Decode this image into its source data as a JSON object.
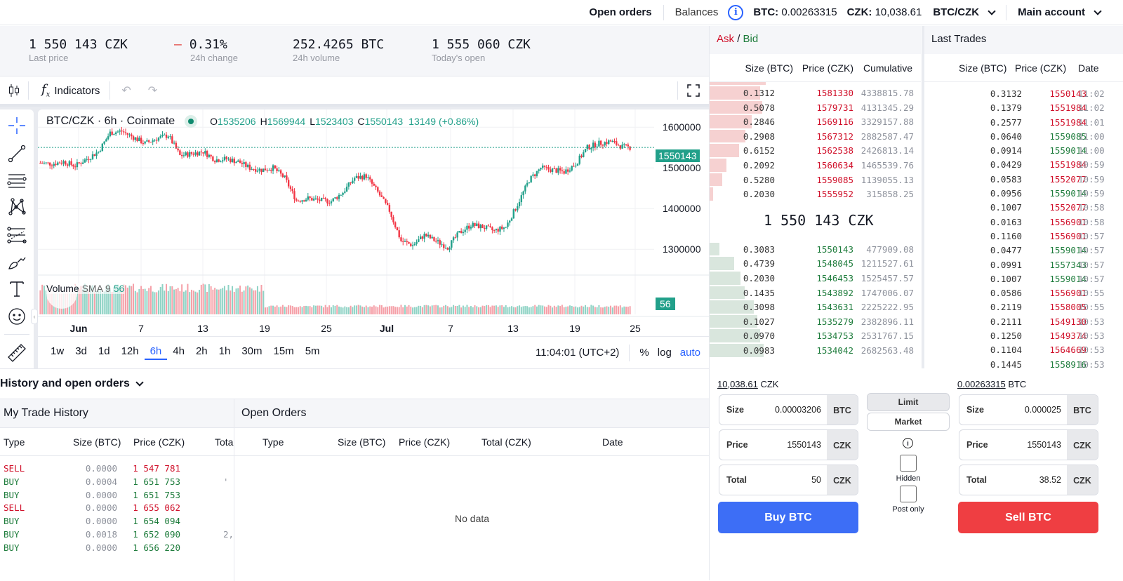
{
  "topbar": {
    "open_orders": "Open orders",
    "balances": "Balances",
    "btc_label": "BTC:",
    "btc_value": "0.00263315",
    "czk_label": "CZK:",
    "czk_value": "10,038.61",
    "pair": "BTC/CZK",
    "account": "Main account",
    "info_glyph": "i"
  },
  "stats": [
    {
      "value": "1 550 143 CZK",
      "label": "Last price"
    },
    {
      "value": "0.31%",
      "label": "24h change",
      "sign": "—"
    },
    {
      "value": "252.4265 BTC",
      "label": "24h volume"
    },
    {
      "value": "1 555 060 CZK",
      "label": "Today's open"
    }
  ],
  "chart_toolbar": {
    "indicators": "Indicators",
    "fx_glyph": "f",
    "fx_sub": "x"
  },
  "chart": {
    "symbol": "BTC/CZK · 6h · Coinmate",
    "o_label": "O",
    "o": "1535206",
    "h_label": "H",
    "h": "1569944",
    "l_label": "L",
    "l": "1523403",
    "c_label": "C",
    "c": "1550143",
    "change": "13149 (+0.86%)",
    "price_tag": "1550143",
    "volume_label": "Volume",
    "sma_label": "SMA 9",
    "sma_value": "56",
    "volume_tag": "56",
    "timestamp": "11:04:01 (UTC+2)",
    "pct": "%",
    "log": "log",
    "auto": "auto",
    "intervals": [
      "1w",
      "3d",
      "1d",
      "12h",
      "6h",
      "4h",
      "2h",
      "1h",
      "30m",
      "15m",
      "5m"
    ],
    "active_interval": "6h"
  },
  "chart_data": {
    "type": "candlestick",
    "title": "BTC/CZK · 6h · Coinmate",
    "y_ticks": [
      "1600000",
      "1500000",
      "1400000",
      "1300000"
    ],
    "ylim": [
      1240000,
      1640000
    ],
    "x_ticks": [
      "Jun",
      "7",
      "13",
      "19",
      "25",
      "Jul",
      "7",
      "13",
      "19",
      "25"
    ],
    "last_price": 1550143,
    "colors": {
      "up": "#22a08a",
      "down": "#f23645",
      "up_vol": "#8fd3c5",
      "down_vol": "#f5a0a8"
    },
    "anchors": [
      [
        0,
        1512000
      ],
      [
        6,
        1510000
      ],
      [
        12,
        1515000
      ],
      [
        18,
        1505000
      ],
      [
        24,
        1522000
      ],
      [
        30,
        1540000
      ],
      [
        36,
        1586000
      ],
      [
        42,
        1590000
      ],
      [
        48,
        1575000
      ],
      [
        54,
        1560000
      ],
      [
        60,
        1572000
      ],
      [
        66,
        1580000
      ],
      [
        72,
        1530000
      ],
      [
        78,
        1535000
      ],
      [
        84,
        1540000
      ],
      [
        90,
        1520000
      ],
      [
        96,
        1522000
      ],
      [
        102,
        1515000
      ],
      [
        108,
        1500000
      ],
      [
        114,
        1495000
      ],
      [
        120,
        1500000
      ],
      [
        126,
        1475000
      ],
      [
        132,
        1420000
      ],
      [
        138,
        1425000
      ],
      [
        144,
        1420000
      ],
      [
        150,
        1418000
      ],
      [
        156,
        1440000
      ],
      [
        162,
        1475000
      ],
      [
        168,
        1480000
      ],
      [
        174,
        1440000
      ],
      [
        180,
        1395000
      ],
      [
        186,
        1320000
      ],
      [
        192,
        1310000
      ],
      [
        198,
        1335000
      ],
      [
        204,
        1320000
      ],
      [
        210,
        1305000
      ],
      [
        216,
        1340000
      ],
      [
        222,
        1360000
      ],
      [
        228,
        1355000
      ],
      [
        234,
        1345000
      ],
      [
        240,
        1355000
      ],
      [
        246,
        1410000
      ],
      [
        252,
        1470000
      ],
      [
        258,
        1500000
      ],
      [
        264,
        1495000
      ],
      [
        270,
        1490000
      ],
      [
        276,
        1510000
      ],
      [
        282,
        1550000
      ],
      [
        288,
        1560000
      ],
      [
        294,
        1565000
      ],
      [
        300,
        1552000
      ],
      [
        304,
        1550143
      ]
    ],
    "volume_levels": {
      "jun_start_to_jun21": 0.8,
      "jun22_to_end": 0.25
    }
  },
  "orderbook": {
    "title_ask": "Ask",
    "title_sep": "/",
    "title_bid": "Bid",
    "columns": [
      "Size (BTC)",
      "Price (CZK)",
      "Cumulative"
    ],
    "mid_price": "1 550 143 CZK",
    "asks": [
      {
        "size": "0.1312",
        "price": "1581330",
        "cum": "4338815.78",
        "depth": 0.24
      },
      {
        "size": "0.5078",
        "price": "1579731",
        "cum": "4131345.29",
        "depth": 0.25
      },
      {
        "size": "0.2846",
        "price": "1569116",
        "cum": "3329157.88",
        "depth": 0.2
      },
      {
        "size": "0.2908",
        "price": "1567312",
        "cum": "2882587.47",
        "depth": 0.17
      },
      {
        "size": "0.6152",
        "price": "1562538",
        "cum": "2426813.14",
        "depth": 0.14
      },
      {
        "size": "0.2092",
        "price": "1560634",
        "cum": "1465539.76",
        "depth": 0.08
      },
      {
        "size": "0.5280",
        "price": "1559085",
        "cum": "1139055.13",
        "depth": 0.06
      },
      {
        "size": "0.2030",
        "price": "1555952",
        "cum": "315858.25",
        "depth": 0.018
      }
    ],
    "bids": [
      {
        "size": "0.3083",
        "price": "1550143",
        "cum": "477909.08",
        "depth": 0.045
      },
      {
        "size": "0.4739",
        "price": "1548045",
        "cum": "1211527.61",
        "depth": 0.115
      },
      {
        "size": "0.2030",
        "price": "1546453",
        "cum": "1525457.57",
        "depth": 0.145
      },
      {
        "size": "0.1435",
        "price": "1543892",
        "cum": "1747006.07",
        "depth": 0.165
      },
      {
        "size": "0.3098",
        "price": "1543631",
        "cum": "2225222.95",
        "depth": 0.21
      },
      {
        "size": "0.1027",
        "price": "1535279",
        "cum": "2382896.11",
        "depth": 0.225
      },
      {
        "size": "0.0970",
        "price": "1534753",
        "cum": "2531767.15",
        "depth": 0.24
      },
      {
        "size": "0.0983",
        "price": "1534042",
        "cum": "2682563.48",
        "depth": 0.255
      }
    ]
  },
  "last_trades": {
    "title": "Last Trades",
    "columns": [
      "Size (BTC)",
      "Price (CZK)",
      "Date"
    ],
    "rows": [
      {
        "size": "0.3132",
        "price": "1550143",
        "time": "11:02",
        "side": "sell"
      },
      {
        "size": "0.1379",
        "price": "1551984",
        "time": "11:02",
        "side": "sell"
      },
      {
        "size": "0.2577",
        "price": "1551984",
        "time": "11:01",
        "side": "sell"
      },
      {
        "size": "0.0640",
        "price": "1559085",
        "time": "11:00",
        "side": "buy"
      },
      {
        "size": "0.0914",
        "price": "1559014",
        "time": "11:00",
        "side": "buy"
      },
      {
        "size": "0.0429",
        "price": "1551984",
        "time": "10:59",
        "side": "sell"
      },
      {
        "size": "0.0583",
        "price": "1552077",
        "time": "10:59",
        "side": "sell"
      },
      {
        "size": "0.0956",
        "price": "1559014",
        "time": "10:59",
        "side": "buy"
      },
      {
        "size": "0.1007",
        "price": "1552077",
        "time": "10:58",
        "side": "sell"
      },
      {
        "size": "0.0163",
        "price": "1556901",
        "time": "10:58",
        "side": "sell"
      },
      {
        "size": "0.1160",
        "price": "1556901",
        "time": "10:57",
        "side": "sell"
      },
      {
        "size": "0.0477",
        "price": "1559014",
        "time": "10:57",
        "side": "buy"
      },
      {
        "size": "0.0991",
        "price": "1557343",
        "time": "10:57",
        "side": "buy"
      },
      {
        "size": "0.1007",
        "price": "1559014",
        "time": "10:57",
        "side": "buy"
      },
      {
        "size": "0.0586",
        "price": "1556901",
        "time": "10:55",
        "side": "sell"
      },
      {
        "size": "0.2119",
        "price": "1558005",
        "time": "10:55",
        "side": "sell"
      },
      {
        "size": "0.2111",
        "price": "1549130",
        "time": "10:53",
        "side": "sell"
      },
      {
        "size": "0.1250",
        "price": "1549374",
        "time": "10:53",
        "side": "sell"
      },
      {
        "size": "0.1104",
        "price": "1564669",
        "time": "10:53",
        "side": "sell"
      },
      {
        "size": "0.1445",
        "price": "1558916",
        "time": "10:53",
        "side": "buy"
      }
    ]
  },
  "history": {
    "title": "History and open orders",
    "my_trades_title": "My Trade History",
    "my_trades_columns": [
      "Type",
      "Size (BTC)",
      "Price (CZK)",
      "Tota"
    ],
    "my_trades": [
      {
        "type": "SELL",
        "size": "0.0000",
        "price": "1 547 781",
        "total": ""
      },
      {
        "type": "BUY",
        "size": "0.0004",
        "price": "1 651 753",
        "total": "'"
      },
      {
        "type": "BUY",
        "size": "0.0000",
        "price": "1 651 753",
        "total": ""
      },
      {
        "type": "SELL",
        "size": "0.0000",
        "price": "1 655 062",
        "total": ""
      },
      {
        "type": "BUY",
        "size": "0.0000",
        "price": "1 654 094",
        "total": ""
      },
      {
        "type": "BUY",
        "size": "0.0018",
        "price": "1 652 090",
        "total": "2,"
      },
      {
        "type": "BUY",
        "size": "0.0000",
        "price": "1 656 220",
        "total": ""
      }
    ],
    "open_orders_title": "Open Orders",
    "open_orders_columns": [
      "Type",
      "Size (BTC)",
      "Price (CZK)",
      "Total (CZK)",
      "Date"
    ],
    "open_orders_empty": "No data"
  },
  "trade": {
    "buy": {
      "balance": "10,038.61",
      "balance_unit": "CZK",
      "fields": [
        {
          "label": "Size",
          "value": "0.00003206",
          "unit": "BTC"
        },
        {
          "label": "Price",
          "value": "1550143",
          "unit": "CZK"
        },
        {
          "label": "Total",
          "value": "50",
          "unit": "CZK"
        }
      ],
      "button": "Buy BTC"
    },
    "sell": {
      "balance": "0.00263315",
      "balance_unit": "BTC",
      "fields": [
        {
          "label": "Size",
          "value": "0.000025",
          "unit": "BTC"
        },
        {
          "label": "Price",
          "value": "1550143",
          "unit": "CZK"
        },
        {
          "label": "Total",
          "value": "38.52",
          "unit": "CZK"
        }
      ],
      "button": "Sell BTC"
    },
    "order_types": [
      "Limit",
      "Market"
    ],
    "active_order_type": "Limit",
    "info_glyph": "i",
    "hidden": {
      "label": "Hidden",
      "checked": false
    },
    "post_only": {
      "label": "Post only",
      "checked": false
    }
  },
  "colors": {
    "accent": "#2962ff",
    "buy_button": "#3d6ef6",
    "sell_button": "#ef3e42",
    "ask_red": "#d0102a",
    "bid_green": "#1e7c3c",
    "ask_bar": "#f6d1d1",
    "bid_bar": "#d9e6dd",
    "chart_green": "#22a08a"
  }
}
